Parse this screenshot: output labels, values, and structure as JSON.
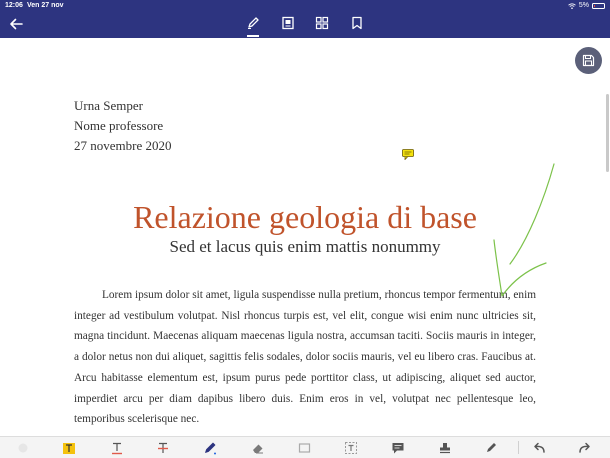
{
  "status_bar": {
    "time": "12:06",
    "date": "Ven 27 nov",
    "battery": "5%"
  },
  "app_toolbar": {
    "back": "back-arrow-icon",
    "tools": [
      "pen-icon",
      "document-view-icon",
      "grid-icon",
      "bookmark-icon"
    ],
    "active_tool": "pen-icon"
  },
  "document": {
    "header_lines": [
      "Urna Semper",
      "Nome professore",
      "27 novembre 2020"
    ],
    "title": "Relazione geologia di base",
    "subtitle": "Sed et lacus quis enim mattis nonummy",
    "body": "Lorem ipsum dolor sit amet, ligula suspendisse nulla pretium, rhoncus tempor fermentum, enim integer ad vestibulum volutpat. Nisl rhoncus turpis est, vel elit, congue wisi enim nunc ultricies sit, magna tincidunt. Maecenas aliquam maecenas ligula nostra, accumsan taciti. Sociis mauris in integer, a dolor netus non dui aliquet, sagittis felis sodales, dolor sociis mauris, vel eu libero cras. Faucibus at. Arcu habitasse elementum est, ipsum purus pede porttitor class, ut adipiscing, aliquet sed auctor, imperdiet arcu per diam dapibus libero duis. Enim eros in vel, volutpat nec pellentesque leo, temporibus scelerisque nec."
  },
  "colors": {
    "bar": "#2d3480",
    "title": "#c0532b",
    "ink": "#7cc24a",
    "highlight": "#f4c20d",
    "save_fab": "#5b6079"
  },
  "bottom_toolbar": [
    "color-swatch-icon",
    "highlight-text-icon",
    "underline-text-icon",
    "strikethrough-text-icon",
    "pen-draw-icon",
    "eraser-icon",
    "shape-icon",
    "text-box-icon",
    "comment-icon",
    "stamp-icon",
    "signature-pen-icon",
    "undo-icon",
    "redo-icon"
  ]
}
